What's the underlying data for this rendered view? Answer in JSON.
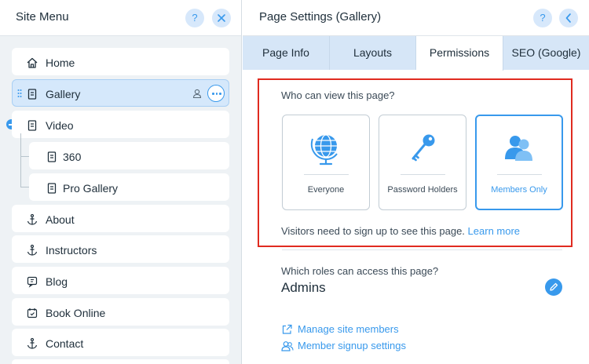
{
  "site_menu": {
    "title": "Site Menu",
    "items": [
      {
        "label": "Home",
        "icon": "home-icon"
      },
      {
        "label": "Gallery",
        "icon": "page-icon"
      },
      {
        "label": "Video",
        "icon": "page-icon"
      },
      {
        "label": "360",
        "icon": "page-icon"
      },
      {
        "label": "Pro Gallery",
        "icon": "page-icon"
      },
      {
        "label": "About",
        "icon": "anchor-icon"
      },
      {
        "label": "Instructors",
        "icon": "anchor-icon"
      },
      {
        "label": "Blog",
        "icon": "blog-icon"
      },
      {
        "label": "Book Online",
        "icon": "calendar-icon"
      },
      {
        "label": "Contact",
        "icon": "anchor-icon"
      }
    ]
  },
  "page_settings": {
    "title": "Page Settings (Gallery)",
    "tabs": [
      "Page Info",
      "Layouts",
      "Permissions",
      "SEO (Google)"
    ],
    "active_tab": "Permissions",
    "who_can_view": "Who can view this page?",
    "options": [
      {
        "label": "Everyone",
        "icon": "globe-icon",
        "selected": false
      },
      {
        "label": "Password Holders",
        "icon": "key-icon",
        "selected": false
      },
      {
        "label": "Members Only",
        "icon": "members-icon",
        "selected": true
      }
    ],
    "note": "Visitors need to sign up to see this page.",
    "learn_more": "Learn more",
    "roles_question": "Which roles can access this page?",
    "roles_value": "Admins",
    "links": [
      "Manage site members",
      "Member signup settings"
    ]
  },
  "colors": {
    "accent": "#3899ec",
    "highlight_border": "#e02b20",
    "selected_row": "#d5e8fb"
  }
}
